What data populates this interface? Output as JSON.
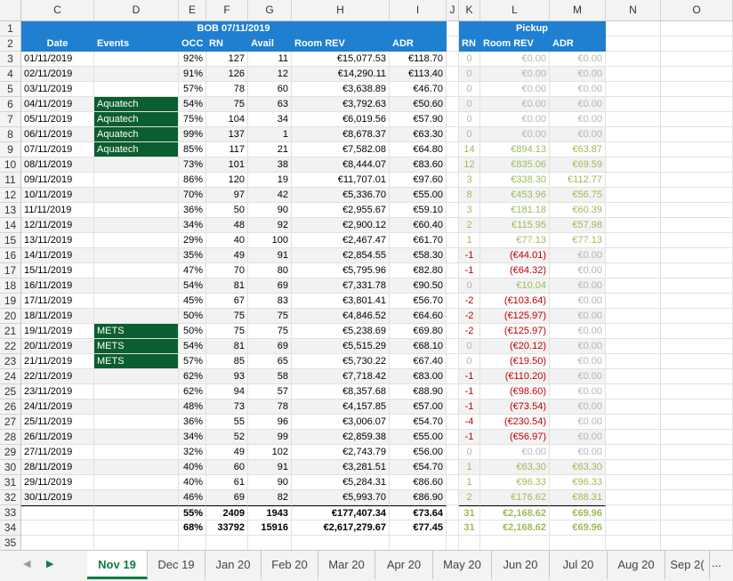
{
  "columns": [
    "C",
    "D",
    "E",
    "F",
    "G",
    "H",
    "I",
    "J",
    "K",
    "L",
    "M",
    "N",
    "O"
  ],
  "header": {
    "bob_title": "BOB 07/11/2019",
    "pickup_title": "Pickup",
    "date": "Date",
    "events": "Events",
    "occ": "OCC",
    "rn": "RN",
    "avail": "Avail",
    "room_rev": "Room REV",
    "adr": "ADR",
    "p_rn": "RN",
    "p_room_rev": "Room REV",
    "p_adr": "ADR"
  },
  "rows": [
    {
      "n": "3",
      "date": "01/11/2019",
      "event": "",
      "occ": "92%",
      "rn": "127",
      "avail": "11",
      "rev": "€15,077.53",
      "adr": "€118.70",
      "prn": "0",
      "prev": "€0.00",
      "padr": "€0.00",
      "pc": "grey"
    },
    {
      "n": "4",
      "date": "02/11/2019",
      "event": "",
      "occ": "91%",
      "rn": "126",
      "avail": "12",
      "rev": "€14,290.11",
      "adr": "€113.40",
      "prn": "0",
      "prev": "€0.00",
      "padr": "€0.00",
      "pc": "grey"
    },
    {
      "n": "5",
      "date": "03/11/2019",
      "event": "",
      "occ": "57%",
      "rn": "78",
      "avail": "60",
      "rev": "€3,638.89",
      "adr": "€46.70",
      "prn": "0",
      "prev": "€0.00",
      "padr": "€0.00",
      "pc": "grey"
    },
    {
      "n": "6",
      "date": "04/11/2019",
      "event": "Aquatech",
      "occ": "54%",
      "rn": "75",
      "avail": "63",
      "rev": "€3,792.63",
      "adr": "€50.60",
      "prn": "0",
      "prev": "€0.00",
      "padr": "€0.00",
      "pc": "grey"
    },
    {
      "n": "7",
      "date": "05/11/2019",
      "event": "Aquatech",
      "occ": "75%",
      "rn": "104",
      "avail": "34",
      "rev": "€6,019.56",
      "adr": "€57.90",
      "prn": "0",
      "prev": "€0.00",
      "padr": "€0.00",
      "pc": "grey"
    },
    {
      "n": "8",
      "date": "06/11/2019",
      "event": "Aquatech",
      "occ": "99%",
      "rn": "137",
      "avail": "1",
      "rev": "€8,678.37",
      "adr": "€63.30",
      "prn": "0",
      "prev": "€0.00",
      "padr": "€0.00",
      "pc": "grey"
    },
    {
      "n": "9",
      "date": "07/11/2019",
      "event": "Aquatech",
      "occ": "85%",
      "rn": "117",
      "avail": "21",
      "rev": "€7,582.08",
      "adr": "€64.80",
      "prn": "14",
      "prev": "€894.13",
      "padr": "€63.87",
      "pc": "green"
    },
    {
      "n": "10",
      "date": "08/11/2019",
      "event": "",
      "occ": "73%",
      "rn": "101",
      "avail": "38",
      "rev": "€8,444.07",
      "adr": "€83.60",
      "prn": "12",
      "prev": "€835.06",
      "padr": "€69.59",
      "pc": "green"
    },
    {
      "n": "11",
      "date": "09/11/2019",
      "event": "",
      "occ": "86%",
      "rn": "120",
      "avail": "19",
      "rev": "€11,707.01",
      "adr": "€97.60",
      "prn": "3",
      "prev": "€338.30",
      "padr": "€112.77",
      "pc": "green"
    },
    {
      "n": "12",
      "date": "10/11/2019",
      "event": "",
      "occ": "70%",
      "rn": "97",
      "avail": "42",
      "rev": "€5,336.70",
      "adr": "€55.00",
      "prn": "8",
      "prev": "€453.96",
      "padr": "€56.75",
      "pc": "green"
    },
    {
      "n": "13",
      "date": "11/11/2019",
      "event": "",
      "occ": "36%",
      "rn": "50",
      "avail": "90",
      "rev": "€2,955.67",
      "adr": "€59.10",
      "prn": "3",
      "prev": "€181.18",
      "padr": "€60.39",
      "pc": "green"
    },
    {
      "n": "14",
      "date": "12/11/2019",
      "event": "",
      "occ": "34%",
      "rn": "48",
      "avail": "92",
      "rev": "€2,900.12",
      "adr": "€60.40",
      "prn": "2",
      "prev": "€115.95",
      "padr": "€57.98",
      "pc": "green"
    },
    {
      "n": "15",
      "date": "13/11/2019",
      "event": "",
      "occ": "29%",
      "rn": "40",
      "avail": "100",
      "rev": "€2,467.47",
      "adr": "€61.70",
      "prn": "1",
      "prev": "€77.13",
      "padr": "€77.13",
      "pc": "green"
    },
    {
      "n": "16",
      "date": "14/11/2019",
      "event": "",
      "occ": "35%",
      "rn": "49",
      "avail": "91",
      "rev": "€2,854.55",
      "adr": "€58.30",
      "prn": "-1",
      "prev": "(€44.01)",
      "padr": "€0.00",
      "pc": "red"
    },
    {
      "n": "17",
      "date": "15/11/2019",
      "event": "",
      "occ": "47%",
      "rn": "70",
      "avail": "80",
      "rev": "€5,795.96",
      "adr": "€82.80",
      "prn": "-1",
      "prev": "(€64.32)",
      "padr": "€0.00",
      "pc": "red"
    },
    {
      "n": "18",
      "date": "16/11/2019",
      "event": "",
      "occ": "54%",
      "rn": "81",
      "avail": "69",
      "rev": "€7,331.78",
      "adr": "€90.50",
      "prn": "0",
      "prev": "€10.04",
      "padr": "€0.00",
      "pc": "mix"
    },
    {
      "n": "19",
      "date": "17/11/2019",
      "event": "",
      "occ": "45%",
      "rn": "67",
      "avail": "83",
      "rev": "€3,801.41",
      "adr": "€56.70",
      "prn": "-2",
      "prev": "(€103.64)",
      "padr": "€0.00",
      "pc": "red"
    },
    {
      "n": "20",
      "date": "18/11/2019",
      "event": "",
      "occ": "50%",
      "rn": "75",
      "avail": "75",
      "rev": "€4,846.52",
      "adr": "€64.60",
      "prn": "-2",
      "prev": "(€125.97)",
      "padr": "€0.00",
      "pc": "red"
    },
    {
      "n": "21",
      "date": "19/11/2019",
      "event": "METS",
      "occ": "50%",
      "rn": "75",
      "avail": "75",
      "rev": "€5,238.69",
      "adr": "€69.80",
      "prn": "-2",
      "prev": "(€125.97)",
      "padr": "€0.00",
      "pc": "red"
    },
    {
      "n": "22",
      "date": "20/11/2019",
      "event": "METS",
      "occ": "54%",
      "rn": "81",
      "avail": "69",
      "rev": "€5,515.29",
      "adr": "€68.10",
      "prn": "0",
      "prev": "(€20.12)",
      "padr": "€0.00",
      "pc": "redz"
    },
    {
      "n": "23",
      "date": "21/11/2019",
      "event": "METS",
      "occ": "57%",
      "rn": "85",
      "avail": "65",
      "rev": "€5,730.22",
      "adr": "€67.40",
      "prn": "0",
      "prev": "(€19.50)",
      "padr": "€0.00",
      "pc": "redz"
    },
    {
      "n": "24",
      "date": "22/11/2019",
      "event": "",
      "occ": "62%",
      "rn": "93",
      "avail": "58",
      "rev": "€7,718.42",
      "adr": "€83.00",
      "prn": "-1",
      "prev": "(€110.20)",
      "padr": "€0.00",
      "pc": "red"
    },
    {
      "n": "25",
      "date": "23/11/2019",
      "event": "",
      "occ": "62%",
      "rn": "94",
      "avail": "57",
      "rev": "€8,357.68",
      "adr": "€88.90",
      "prn": "-1",
      "prev": "(€98.60)",
      "padr": "€0.00",
      "pc": "red"
    },
    {
      "n": "26",
      "date": "24/11/2019",
      "event": "",
      "occ": "48%",
      "rn": "73",
      "avail": "78",
      "rev": "€4,157.85",
      "adr": "€57.00",
      "prn": "-1",
      "prev": "(€73.54)",
      "padr": "€0.00",
      "pc": "red"
    },
    {
      "n": "27",
      "date": "25/11/2019",
      "event": "",
      "occ": "36%",
      "rn": "55",
      "avail": "96",
      "rev": "€3,006.07",
      "adr": "€54.70",
      "prn": "-4",
      "prev": "(€230.54)",
      "padr": "€0.00",
      "pc": "red"
    },
    {
      "n": "28",
      "date": "26/11/2019",
      "event": "",
      "occ": "34%",
      "rn": "52",
      "avail": "99",
      "rev": "€2,859.38",
      "adr": "€55.00",
      "prn": "-1",
      "prev": "(€56.97)",
      "padr": "€0.00",
      "pc": "red"
    },
    {
      "n": "29",
      "date": "27/11/2019",
      "event": "",
      "occ": "32%",
      "rn": "49",
      "avail": "102",
      "rev": "€2,743.79",
      "adr": "€56.00",
      "prn": "0",
      "prev": "€0.00",
      "padr": "€0.00",
      "pc": "grey"
    },
    {
      "n": "30",
      "date": "28/11/2019",
      "event": "",
      "occ": "40%",
      "rn": "60",
      "avail": "91",
      "rev": "€3,281.51",
      "adr": "€54.70",
      "prn": "1",
      "prev": "€63.30",
      "padr": "€63.30",
      "pc": "green"
    },
    {
      "n": "31",
      "date": "29/11/2019",
      "event": "",
      "occ": "40%",
      "rn": "61",
      "avail": "90",
      "rev": "€5,284.31",
      "adr": "€86.60",
      "prn": "1",
      "prev": "€96.33",
      "padr": "€96.33",
      "pc": "green"
    },
    {
      "n": "32",
      "date": "30/11/2019",
      "event": "",
      "occ": "46%",
      "rn": "69",
      "avail": "82",
      "rev": "€5,993.70",
      "adr": "€86.90",
      "prn": "2",
      "prev": "€176.62",
      "padr": "€88.31",
      "pc": "green"
    }
  ],
  "totals": [
    {
      "n": "33",
      "occ": "55%",
      "rn": "2409",
      "avail": "1943",
      "rev": "€177,407.34",
      "adr": "€73.64",
      "prn": "31",
      "prev": "€2,168.62",
      "padr": "€69.96"
    },
    {
      "n": "34",
      "occ": "68%",
      "rn": "33792",
      "avail": "15916",
      "rev": "€2,617,279.67",
      "adr": "€77.45",
      "prn": "31",
      "prev": "€2,168.62",
      "padr": "€69.96"
    }
  ],
  "header_rows": [
    "1",
    "2"
  ],
  "last_row": "35",
  "tabs": [
    "Nov 19",
    "Dec 19",
    "Jan 20",
    "Feb 20",
    "Mar 20",
    "Apr 20",
    "May 20",
    "Jun 20",
    "Jul 20",
    "Aug 20",
    "Sep 2("
  ],
  "nav": {
    "prev": "◀",
    "next": "▶",
    "more": "..."
  },
  "colors": {
    "header_blue": "#1f7fd0",
    "event_green": "#0b5e2f",
    "pickup_green": "#9dbb59",
    "pickup_red": "#c00000",
    "active_tab": "#107c41"
  }
}
